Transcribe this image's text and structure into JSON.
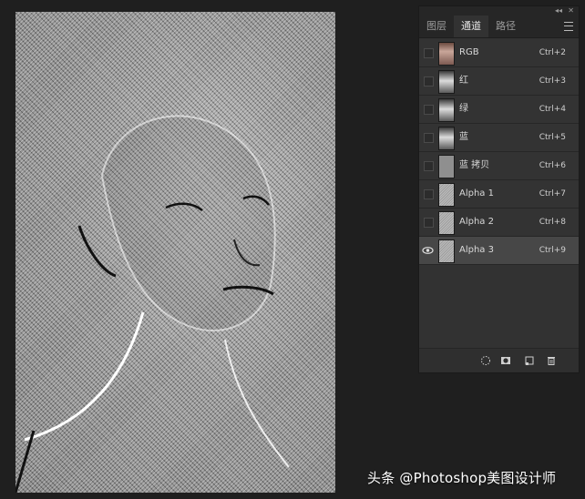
{
  "panel": {
    "tabs": [
      {
        "label": "图层",
        "active": false
      },
      {
        "label": "通道",
        "active": true
      },
      {
        "label": "路径",
        "active": false
      }
    ],
    "channels": [
      {
        "name": "RGB",
        "shortcut": "Ctrl+2",
        "thumb": "rgb",
        "visible": false,
        "selected": false
      },
      {
        "name": "红",
        "shortcut": "Ctrl+3",
        "thumb": "gray",
        "visible": false,
        "selected": false
      },
      {
        "name": "绿",
        "shortcut": "Ctrl+4",
        "thumb": "gray",
        "visible": false,
        "selected": false
      },
      {
        "name": "蓝",
        "shortcut": "Ctrl+5",
        "thumb": "gray",
        "visible": false,
        "selected": false
      },
      {
        "name": "蓝 拷贝",
        "shortcut": "Ctrl+6",
        "thumb": "flat",
        "visible": false,
        "selected": false
      },
      {
        "name": "Alpha 1",
        "shortcut": "Ctrl+7",
        "thumb": "alpha",
        "visible": false,
        "selected": false
      },
      {
        "name": "Alpha 2",
        "shortcut": "Ctrl+8",
        "thumb": "alpha",
        "visible": false,
        "selected": false
      },
      {
        "name": "Alpha 3",
        "shortcut": "Ctrl+9",
        "thumb": "alpha",
        "visible": true,
        "selected": true
      }
    ],
    "footer_icons": [
      "load-selection-icon",
      "save-selection-icon",
      "new-channel-icon",
      "delete-icon"
    ]
  },
  "watermark": "头条 @Photoshop美图设计师",
  "colors": {
    "panel_bg": "#323232",
    "selected_row": "#474747",
    "canvas_bg": "#1f1f1f"
  }
}
